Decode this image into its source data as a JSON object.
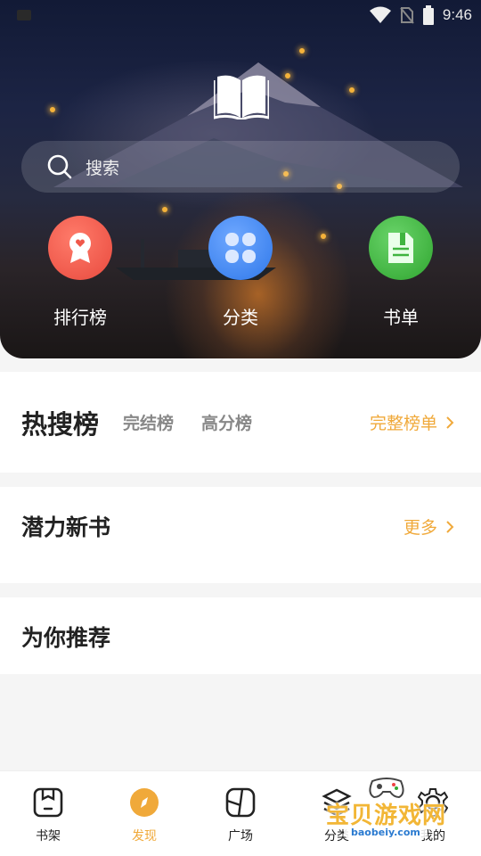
{
  "status_bar": {
    "time": "9:46"
  },
  "search": {
    "placeholder": "搜索"
  },
  "quick_entries": [
    {
      "label": "排行榜",
      "icon": "ranking-ribbon-icon",
      "color": "#f0584a"
    },
    {
      "label": "分类",
      "icon": "category-grid-icon",
      "color": "#3d86f0"
    },
    {
      "label": "书单",
      "icon": "booklist-icon",
      "color": "#3fb43f"
    }
  ],
  "hot_section": {
    "title": "热搜榜",
    "tabs": [
      "完结榜",
      "高分榜"
    ],
    "more_label": "完整榜单"
  },
  "potential_section": {
    "title": "潜力新书",
    "more_label": "更多"
  },
  "recommend_section": {
    "title": "为你推荐"
  },
  "bottom_nav": [
    {
      "label": "书架",
      "icon": "bookshelf-icon",
      "active": false
    },
    {
      "label": "发现",
      "icon": "discover-compass-icon",
      "active": true
    },
    {
      "label": "广场",
      "icon": "plaza-icon",
      "active": false
    },
    {
      "label": "分类",
      "icon": "category-layers-icon",
      "active": false
    },
    {
      "label": "我的",
      "icon": "profile-gear-icon",
      "active": false
    }
  ],
  "watermark": {
    "text": "宝贝游戏网",
    "url": "baobeiy.com"
  },
  "colors": {
    "accent": "#f0a93a",
    "text": "#222222",
    "muted": "#888888"
  }
}
